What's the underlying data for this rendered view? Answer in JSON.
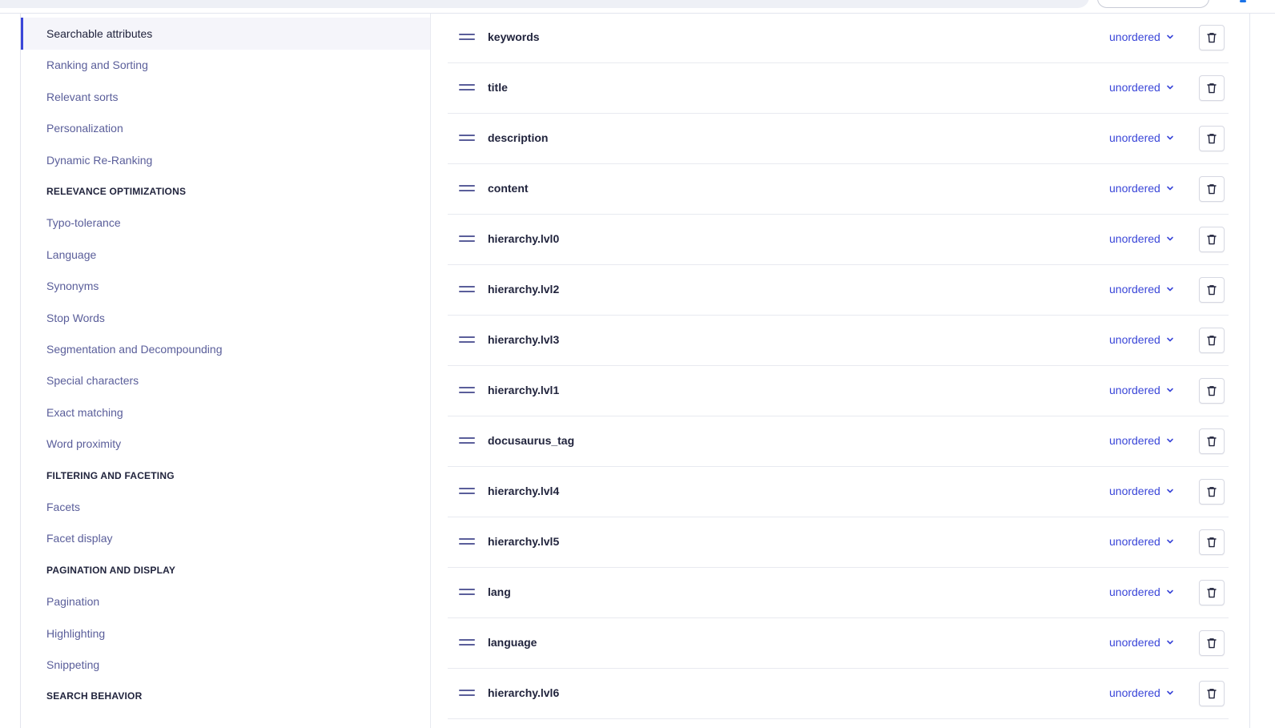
{
  "colors": {
    "accent": "#3a46d8",
    "text_primary": "#21243d",
    "text_link": "#5a5e9a",
    "border": "#e8eaf0"
  },
  "sidebar": {
    "items": [
      {
        "type": "item",
        "label": "Searchable attributes",
        "active": true
      },
      {
        "type": "item",
        "label": "Ranking and Sorting"
      },
      {
        "type": "item",
        "label": "Relevant sorts"
      },
      {
        "type": "item",
        "label": "Personalization"
      },
      {
        "type": "item",
        "label": "Dynamic Re-Ranking"
      },
      {
        "type": "heading",
        "label": "RELEVANCE OPTIMIZATIONS"
      },
      {
        "type": "item",
        "label": "Typo-tolerance"
      },
      {
        "type": "item",
        "label": "Language"
      },
      {
        "type": "item",
        "label": "Synonyms"
      },
      {
        "type": "item",
        "label": "Stop Words"
      },
      {
        "type": "item",
        "label": "Segmentation and Decompounding"
      },
      {
        "type": "item",
        "label": "Special characters"
      },
      {
        "type": "item",
        "label": "Exact matching"
      },
      {
        "type": "item",
        "label": "Word proximity"
      },
      {
        "type": "heading",
        "label": "FILTERING AND FACETING"
      },
      {
        "type": "item",
        "label": "Facets"
      },
      {
        "type": "item",
        "label": "Facet display"
      },
      {
        "type": "heading",
        "label": "PAGINATION AND DISPLAY"
      },
      {
        "type": "item",
        "label": "Pagination"
      },
      {
        "type": "item",
        "label": "Highlighting"
      },
      {
        "type": "item",
        "label": "Snippeting"
      },
      {
        "type": "heading",
        "label": "SEARCH BEHAVIOR"
      }
    ]
  },
  "attributes": [
    {
      "name": "keywords",
      "order": "unordered"
    },
    {
      "name": "title",
      "order": "unordered"
    },
    {
      "name": "description",
      "order": "unordered"
    },
    {
      "name": "content",
      "order": "unordered"
    },
    {
      "name": "hierarchy.lvl0",
      "order": "unordered"
    },
    {
      "name": "hierarchy.lvl2",
      "order": "unordered"
    },
    {
      "name": "hierarchy.lvl3",
      "order": "unordered"
    },
    {
      "name": "hierarchy.lvl1",
      "order": "unordered"
    },
    {
      "name": "docusaurus_tag",
      "order": "unordered"
    },
    {
      "name": "hierarchy.lvl4",
      "order": "unordered"
    },
    {
      "name": "hierarchy.lvl5",
      "order": "unordered"
    },
    {
      "name": "lang",
      "order": "unordered"
    },
    {
      "name": "language",
      "order": "unordered"
    },
    {
      "name": "hierarchy.lvl6",
      "order": "unordered"
    }
  ],
  "icons": {
    "drag": "drag-handle-icon",
    "chevron": "chevron-down-icon",
    "delete": "trash-icon"
  }
}
